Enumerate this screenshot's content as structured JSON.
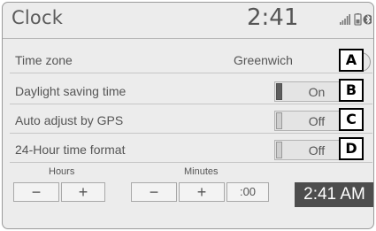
{
  "header": {
    "title": "Clock",
    "time": "2:41"
  },
  "status_icons": [
    "signal-bars-icon",
    "battery-icon",
    "bluetooth-icon"
  ],
  "settings": {
    "time_zone": {
      "label": "Time zone",
      "value": "Greenwich",
      "callout": "A"
    },
    "daylight_saving": {
      "label": "Daylight saving time",
      "state": "On",
      "callout": "B"
    },
    "auto_adjust_gps": {
      "label": "Auto adjust by GPS",
      "state": "Off",
      "callout": "C"
    },
    "hour_format": {
      "label": "24-Hour time format",
      "state": "Off",
      "callout": "D"
    }
  },
  "adjust": {
    "hours_label": "Hours",
    "minutes_label": "Minutes",
    "minus": "−",
    "plus": "+",
    "reset_label": ":00"
  },
  "display_time": "2:41 AM"
}
